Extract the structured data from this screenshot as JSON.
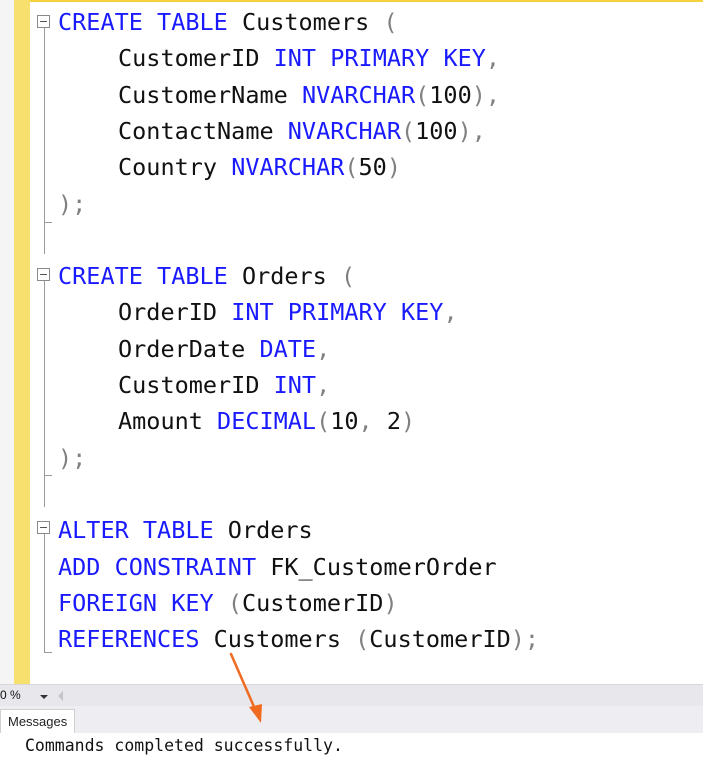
{
  "editor": {
    "lines": [
      [
        {
          "t": "CREATE",
          "c": "kw"
        },
        {
          "t": " "
        },
        {
          "t": "TABLE",
          "c": "kw"
        },
        {
          "t": " Customers "
        },
        {
          "t": "(",
          "c": "gray"
        }
      ],
      [
        {
          "t": "CustomerID "
        },
        {
          "t": "INT",
          "c": "kw"
        },
        {
          "t": " "
        },
        {
          "t": "PRIMARY",
          "c": "kw"
        },
        {
          "t": " "
        },
        {
          "t": "KEY",
          "c": "kw"
        },
        {
          "t": ",",
          "c": "gray"
        }
      ],
      [
        {
          "t": "CustomerName "
        },
        {
          "t": "NVARCHAR",
          "c": "kw"
        },
        {
          "t": "(",
          "c": "gray"
        },
        {
          "t": "100"
        },
        {
          "t": "),",
          "c": "gray"
        }
      ],
      [
        {
          "t": "ContactName "
        },
        {
          "t": "NVARCHAR",
          "c": "kw"
        },
        {
          "t": "(",
          "c": "gray"
        },
        {
          "t": "100"
        },
        {
          "t": "),",
          "c": "gray"
        }
      ],
      [
        {
          "t": "Country "
        },
        {
          "t": "NVARCHAR",
          "c": "kw"
        },
        {
          "t": "(",
          "c": "gray"
        },
        {
          "t": "50"
        },
        {
          "t": ")",
          "c": "gray"
        }
      ],
      [
        {
          "t": ");",
          "c": "gray"
        }
      ],
      [],
      [
        {
          "t": "CREATE",
          "c": "kw"
        },
        {
          "t": " "
        },
        {
          "t": "TABLE",
          "c": "kw"
        },
        {
          "t": " Orders "
        },
        {
          "t": "(",
          "c": "gray"
        }
      ],
      [
        {
          "t": "OrderID "
        },
        {
          "t": "INT",
          "c": "kw"
        },
        {
          "t": " "
        },
        {
          "t": "PRIMARY",
          "c": "kw"
        },
        {
          "t": " "
        },
        {
          "t": "KEY",
          "c": "kw"
        },
        {
          "t": ",",
          "c": "gray"
        }
      ],
      [
        {
          "t": "OrderDate "
        },
        {
          "t": "DATE",
          "c": "kw"
        },
        {
          "t": ",",
          "c": "gray"
        }
      ],
      [
        {
          "t": "CustomerID "
        },
        {
          "t": "INT",
          "c": "kw"
        },
        {
          "t": ",",
          "c": "gray"
        }
      ],
      [
        {
          "t": "Amount "
        },
        {
          "t": "DECIMAL",
          "c": "kw"
        },
        {
          "t": "(",
          "c": "gray"
        },
        {
          "t": "10"
        },
        {
          "t": ", ",
          "c": "gray"
        },
        {
          "t": "2"
        },
        {
          "t": ")",
          "c": "gray"
        }
      ],
      [
        {
          "t": ");",
          "c": "gray"
        }
      ],
      [],
      [
        {
          "t": "ALTER",
          "c": "kw"
        },
        {
          "t": " "
        },
        {
          "t": "TABLE",
          "c": "kw"
        },
        {
          "t": " Orders"
        }
      ],
      [
        {
          "t": "ADD",
          "c": "kw"
        },
        {
          "t": " "
        },
        {
          "t": "CONSTRAINT",
          "c": "kw"
        },
        {
          "t": " FK_CustomerOrder"
        }
      ],
      [
        {
          "t": "FOREIGN",
          "c": "kw"
        },
        {
          "t": " "
        },
        {
          "t": "KEY",
          "c": "kw"
        },
        {
          "t": " "
        },
        {
          "t": "(",
          "c": "gray"
        },
        {
          "t": "CustomerID"
        },
        {
          "t": ")",
          "c": "gray"
        }
      ],
      [
        {
          "t": "REFERENCES",
          "c": "kw"
        },
        {
          "t": " Customers "
        },
        {
          "t": "(",
          "c": "gray"
        },
        {
          "t": "CustomerID"
        },
        {
          "t": ");",
          "c": "gray"
        }
      ]
    ],
    "indented": [
      1,
      2,
      3,
      4,
      8,
      9,
      10,
      11
    ]
  },
  "statusbar": {
    "zoom": "0 %"
  },
  "results": {
    "tab_label": "Messages",
    "message": "Commands completed successfully."
  },
  "colors": {
    "keyword": "#1a1aff",
    "punct": "#808080",
    "change_bar": "#f7e06e",
    "arrow": "#f06a1f"
  }
}
